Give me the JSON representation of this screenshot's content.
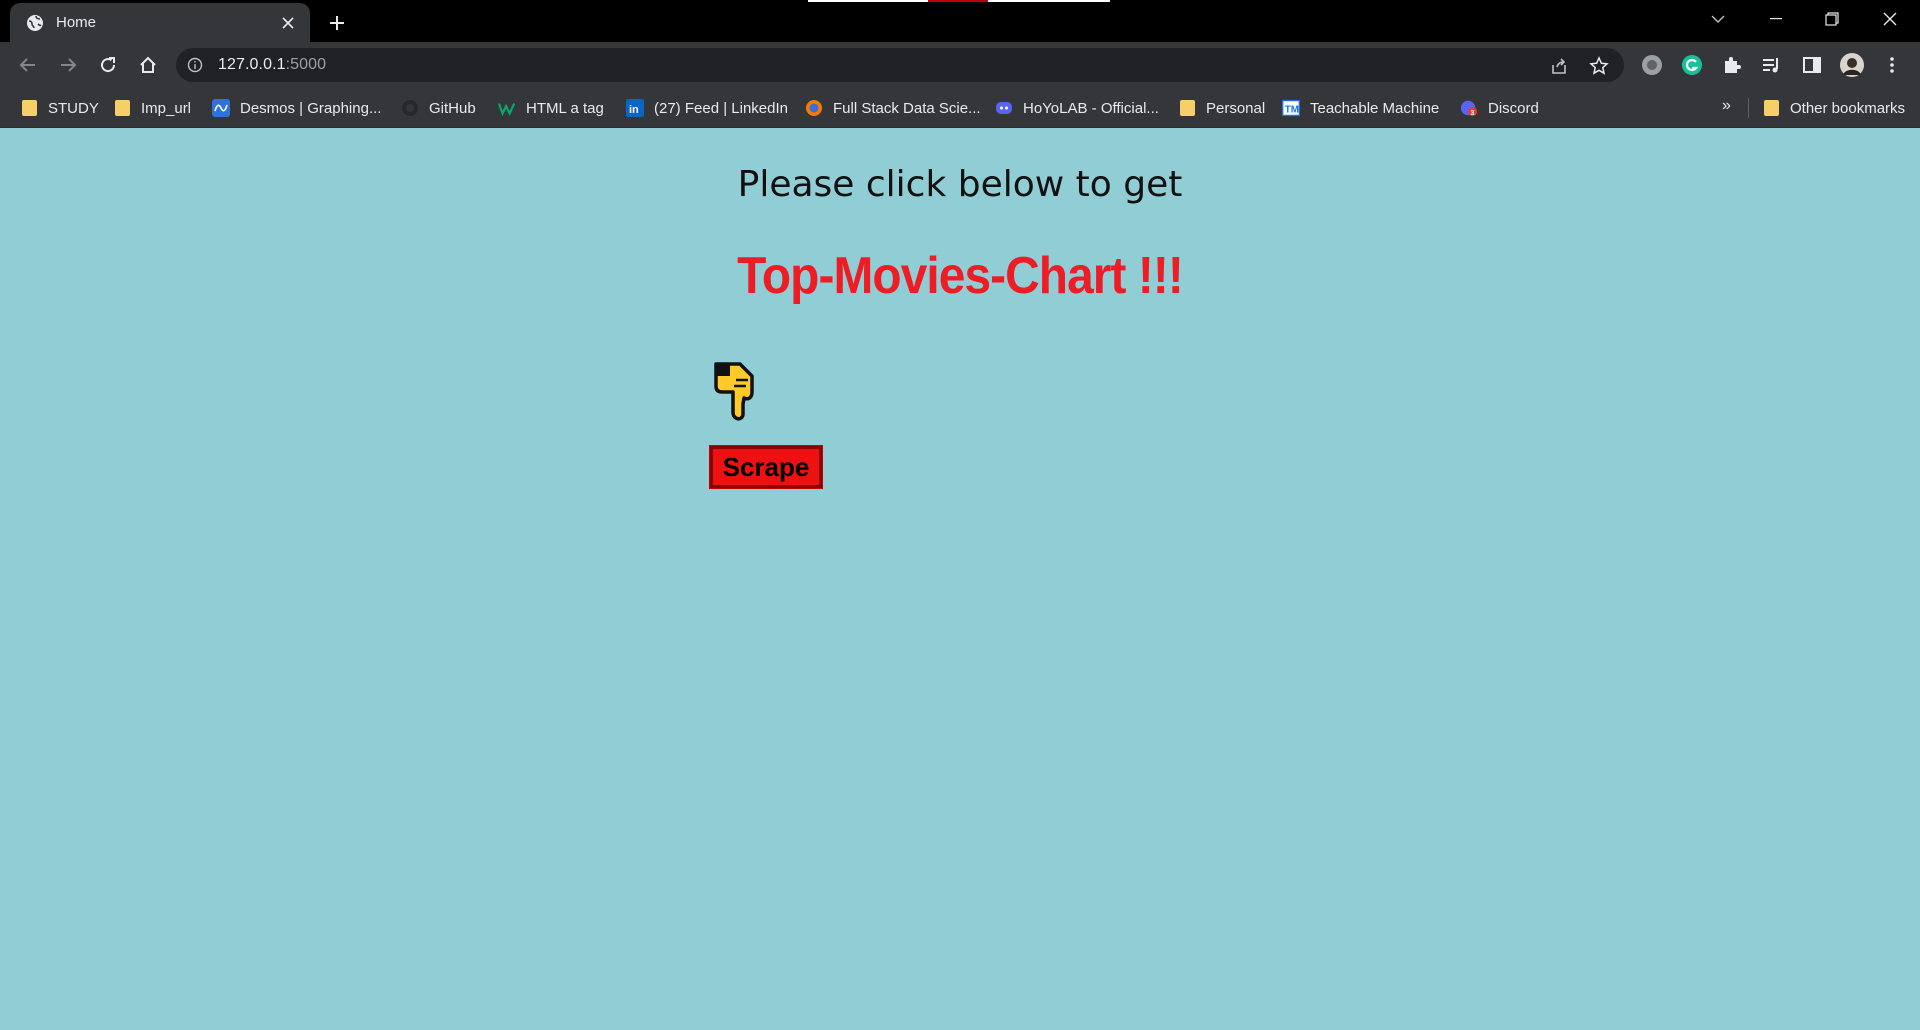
{
  "tab": {
    "title": "Home"
  },
  "address_bar": {
    "host": "127.0.0.1",
    "port": ":5000"
  },
  "bookmarks": [
    {
      "label": "STUDY",
      "icon": "folder-icon"
    },
    {
      "label": "Imp_url",
      "icon": "folder-icon"
    },
    {
      "label": "Desmos | Graphing...",
      "icon": "desmos-icon"
    },
    {
      "label": "GitHub",
      "icon": "github-icon"
    },
    {
      "label": "HTML a tag",
      "icon": "w3schools-icon"
    },
    {
      "label": "(27) Feed | LinkedIn",
      "icon": "linkedin-icon"
    },
    {
      "label": "Full Stack Data Scie...",
      "icon": "ineuron-icon"
    },
    {
      "label": "HoYoLAB - Official...",
      "icon": "discord-style-icon"
    },
    {
      "label": "Personal",
      "icon": "folder-icon"
    },
    {
      "label": "Teachable Machine",
      "icon": "teachable-machine-icon"
    },
    {
      "label": "Discord",
      "icon": "discord-icon"
    }
  ],
  "bookmarks_overflow": "»",
  "other_bookmarks": "Other bookmarks",
  "page": {
    "lead_text": "Please click below to get",
    "headline": "Top-Movies-Chart !!!",
    "pointer_emoji": "👇",
    "button_label": "Scrape"
  },
  "colors": {
    "page_background": "#91cdd4",
    "headline": "#ee1c25",
    "button": "#ee1111"
  }
}
